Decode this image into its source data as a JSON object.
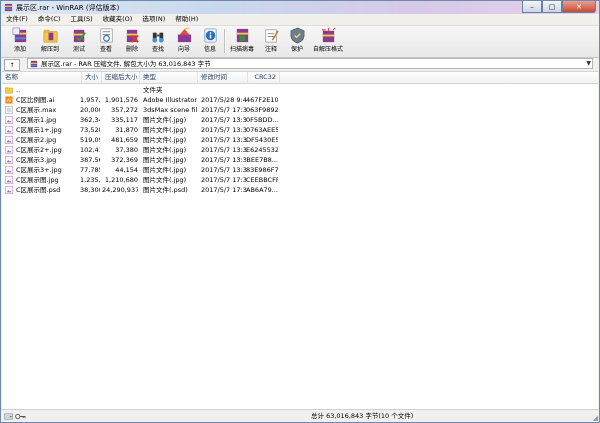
{
  "window": {
    "title": "展示区.rar - WinRAR (评估版本)",
    "minimize": "–",
    "maximize": "□",
    "close": "✕"
  },
  "menu": [
    "文件(F)",
    "命令(C)",
    "工具(S)",
    "收藏夹(O)",
    "选项(N)",
    "帮助(H)"
  ],
  "toolbar": [
    {
      "label": "添加",
      "icon": "add-archive-icon"
    },
    {
      "label": "解压到",
      "icon": "extract-to-icon"
    },
    {
      "label": "测试",
      "icon": "test-icon"
    },
    {
      "label": "查看",
      "icon": "view-icon"
    },
    {
      "label": "删除",
      "icon": "delete-icon"
    },
    {
      "label": "查找",
      "icon": "find-icon"
    },
    {
      "label": "向导",
      "icon": "wizard-icon"
    },
    {
      "label": "信息",
      "icon": "info-icon"
    },
    {
      "label": "扫描病毒",
      "icon": "virus-scan-icon"
    },
    {
      "label": "注释",
      "icon": "comment-icon"
    },
    {
      "label": "保护",
      "icon": "protect-icon"
    },
    {
      "label": "自解压格式",
      "icon": "sfx-icon"
    }
  ],
  "address": {
    "up_label": "↑",
    "path": "展示区.rar - RAR 压缩文件, 解包大小为 63,016,843 字节",
    "dropdown": "▼"
  },
  "columns": [
    "名称",
    "大小",
    "压缩后大小",
    "类型",
    "修改时间",
    "CRC32"
  ],
  "files": [
    {
      "name": "..",
      "size": "",
      "packed": "",
      "type": "文件夹",
      "modified": "",
      "crc": "",
      "kind": "folder"
    },
    {
      "name": "C区比例图.ai",
      "size": "1,957,545",
      "packed": "1,901,576",
      "type": "Adobe Illustrator...",
      "modified": "2017/5/28 9:43",
      "crc": "467F2E10",
      "kind": "ai"
    },
    {
      "name": "C区展示.max",
      "size": "20,000,768",
      "packed": "357,272",
      "type": "3dsMax scene file",
      "modified": "2017/5/7 17:34",
      "crc": "063F9892",
      "kind": "max"
    },
    {
      "name": "C区展示1.jpg",
      "size": "362,340",
      "packed": "335,117",
      "type": "图片文件(.jpg)",
      "modified": "2017/5/7 13:33",
      "crc": "0F5BDD...",
      "kind": "jpg"
    },
    {
      "name": "C区展示1+.jpg",
      "size": "73,528",
      "packed": "31,870",
      "type": "图片文件(.jpg)",
      "modified": "2017/5/7 13:33",
      "crc": "0763AEE5",
      "kind": "jpg"
    },
    {
      "name": "C区展示2.jpg",
      "size": "519,097",
      "packed": "481,659",
      "type": "图片文件(.jpg)",
      "modified": "2017/5/7 13:33",
      "crc": "DF5430E5",
      "kind": "jpg"
    },
    {
      "name": "C区展示2+.jpg",
      "size": "102,411",
      "packed": "37,380",
      "type": "图片文件(.jpg)",
      "modified": "2017/5/7 13:34",
      "crc": "E6245532",
      "kind": "jpg"
    },
    {
      "name": "C区展示3.jpg",
      "size": "387,567",
      "packed": "372,369",
      "type": "图片文件(.jpg)",
      "modified": "2017/5/7 13:36",
      "crc": "BEE7B8...",
      "kind": "jpg"
    },
    {
      "name": "C区展示3+.jpg",
      "size": "77,785",
      "packed": "44,154",
      "type": "图片文件(.jpg)",
      "modified": "2017/5/7 13:36",
      "crc": "83E986F7",
      "kind": "jpg"
    },
    {
      "name": "C区展示图.jpg",
      "size": "1,235,549",
      "packed": "1,210,680",
      "type": "图片文件(.jpg)",
      "modified": "2017/5/7 17:34",
      "crc": "CEEBBCFF",
      "kind": "jpg"
    },
    {
      "name": "C区展示图.psd",
      "size": "38,300,253",
      "packed": "24,290,937",
      "type": "图片文件(.psd)",
      "modified": "2017/5/7 17:34",
      "crc": "AB6A79...",
      "kind": "psd"
    }
  ],
  "status": {
    "summary": "总计 63,016,843 字节(10 个文件)"
  }
}
